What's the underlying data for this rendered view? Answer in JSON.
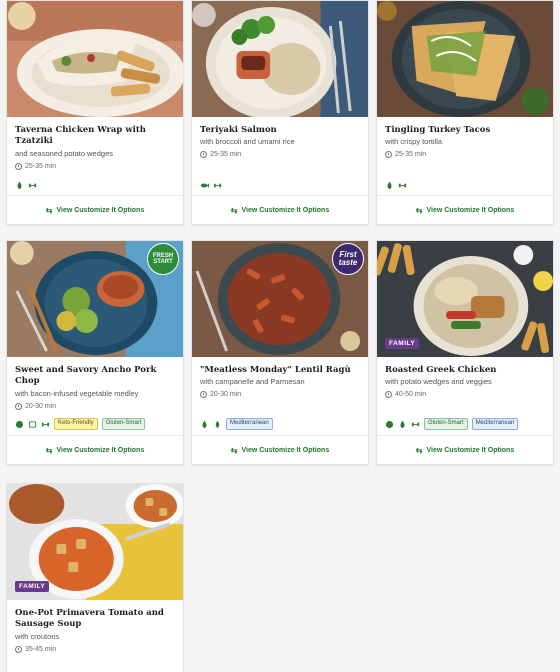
{
  "footer_label": "View Customize It Options",
  "cards": [
    {
      "title": "Taverna Chicken Wrap with Tzatziki",
      "subtitle": "and seasoned potato wedges",
      "time": "25-35 min",
      "icons": [
        "calorie-smart-icon",
        "protein-icon"
      ],
      "tags": []
    },
    {
      "title": "Teriyaki Salmon",
      "subtitle": "with broccoli and umami rice",
      "time": "25-35 min",
      "icons": [
        "fish-icon",
        "protein-icon"
      ],
      "tags": []
    },
    {
      "title": "Tingling Turkey Tacos",
      "subtitle": "with crispy tortilla",
      "time": "25-35 min",
      "icons": [
        "calorie-smart-icon",
        "protein-icon"
      ],
      "tags": []
    },
    {
      "title": "Sweet and Savory Ancho Pork Chop",
      "subtitle": "with bacon-infused vegetable medley",
      "time": "20-30 min",
      "badge": "FRESH START",
      "icons": [
        "carb-smart-icon",
        "easy-cleanup-icon",
        "protein-icon"
      ],
      "tags": [
        "Keto-Friendly",
        "Gluten-Smart"
      ]
    },
    {
      "title": "\"Meatless Monday\" Lentil Ragù",
      "subtitle": "with campanelle and Parmesan",
      "time": "20-30 min",
      "badge": "First taste",
      "icons": [
        "calorie-smart-icon",
        "vegetarian-icon"
      ],
      "tags": [
        "Mediterranean"
      ]
    },
    {
      "title": "Roasted Greek Chicken",
      "subtitle": "with potato wedges and veggies",
      "time": "40-50 min",
      "badge": "FAMILY",
      "icons": [
        "carb-smart-icon",
        "calorie-smart-icon",
        "protein-icon"
      ],
      "tags": [
        "Gluten-Smart",
        "Mediterranean"
      ]
    },
    {
      "title": "One-Pot Primavera Tomato and Sausage Soup",
      "subtitle": "with croutons",
      "time": "35-45 min",
      "badge": "FAMILY",
      "icons": [],
      "tags": []
    }
  ],
  "colors": {
    "accent_green": "#1f7a2c",
    "family_purple": "#6a3a8a",
    "first_taste_navy": "#3b2a6e",
    "fresh_start_green": "#2e8b3a"
  }
}
